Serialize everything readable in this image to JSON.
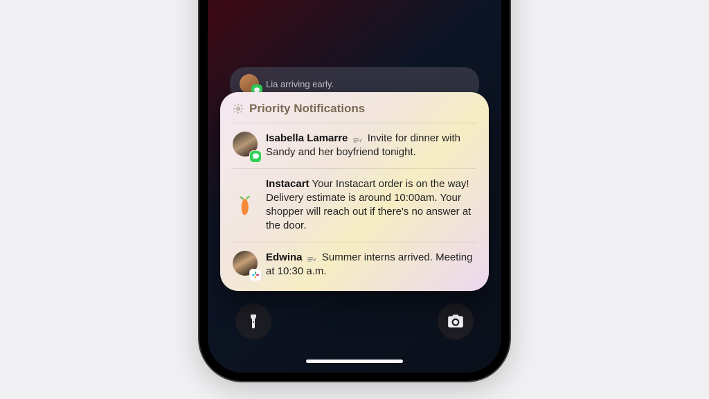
{
  "card": {
    "title": "Priority Notifications"
  },
  "notifications": {
    "item0": {
      "sender": "Isabella Lamarre",
      "message": "Invite for dinner with Sandy and her boyfriend tonight."
    },
    "item1": {
      "sender": "Instacart",
      "message": "Your Instacart order is on the way! Delivery estimate is around 10:00am. Your shopper will reach out if there's no answer at the door."
    },
    "item2": {
      "sender": "Edwina",
      "message": "Summer interns arrived. Meeting at 10:30 a.m."
    }
  },
  "peek": {
    "message": "Lia arriving early."
  }
}
